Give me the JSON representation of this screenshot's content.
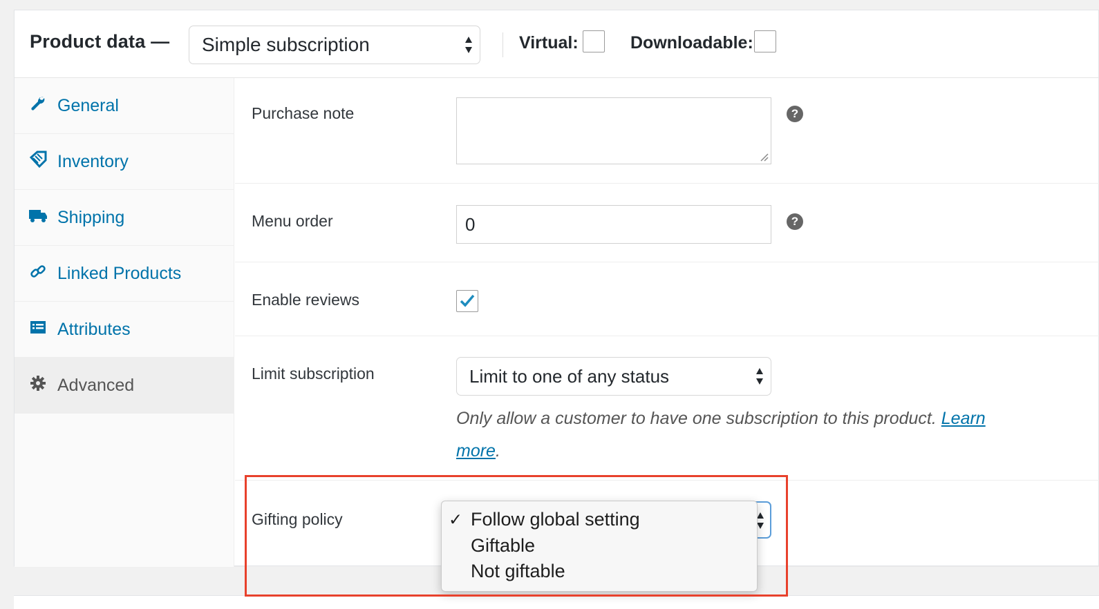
{
  "header": {
    "title": "Product data —",
    "product_type": "Simple subscription",
    "virtual_label": "Virtual:",
    "virtual_checked": false,
    "downloadable_label": "Downloadable:",
    "downloadable_checked": false
  },
  "sidebar": {
    "items": [
      {
        "label": "General",
        "icon": "wrench-icon",
        "active": false
      },
      {
        "label": "Inventory",
        "icon": "tag-icon",
        "active": false
      },
      {
        "label": "Shipping",
        "icon": "truck-icon",
        "active": false
      },
      {
        "label": "Linked Products",
        "icon": "link-icon",
        "active": false
      },
      {
        "label": "Attributes",
        "icon": "list-icon",
        "active": false
      },
      {
        "label": "Advanced",
        "icon": "gear-icon",
        "active": true
      }
    ]
  },
  "fields": {
    "purchase_note": {
      "label": "Purchase note",
      "value": "",
      "help": "?"
    },
    "menu_order": {
      "label": "Menu order",
      "value": "0",
      "help": "?"
    },
    "enable_reviews": {
      "label": "Enable reviews",
      "checked": true
    },
    "limit_subscription": {
      "label": "Limit subscription",
      "value": "Limit to one of any status",
      "description": "Only allow a customer to have one subscription to this product.",
      "learn_more_line1": "Learn",
      "learn_more_line2": "more",
      "period": "."
    },
    "gifting_policy": {
      "label": "Gifting policy",
      "options": [
        {
          "label": "Follow global setting",
          "selected": true
        },
        {
          "label": "Giftable",
          "selected": false
        },
        {
          "label": "Not giftable",
          "selected": false
        }
      ],
      "check_mark": "✓"
    }
  },
  "colors": {
    "link": "#0073aa",
    "highlight": "#e8412c",
    "focus": "#5b9dd9"
  }
}
